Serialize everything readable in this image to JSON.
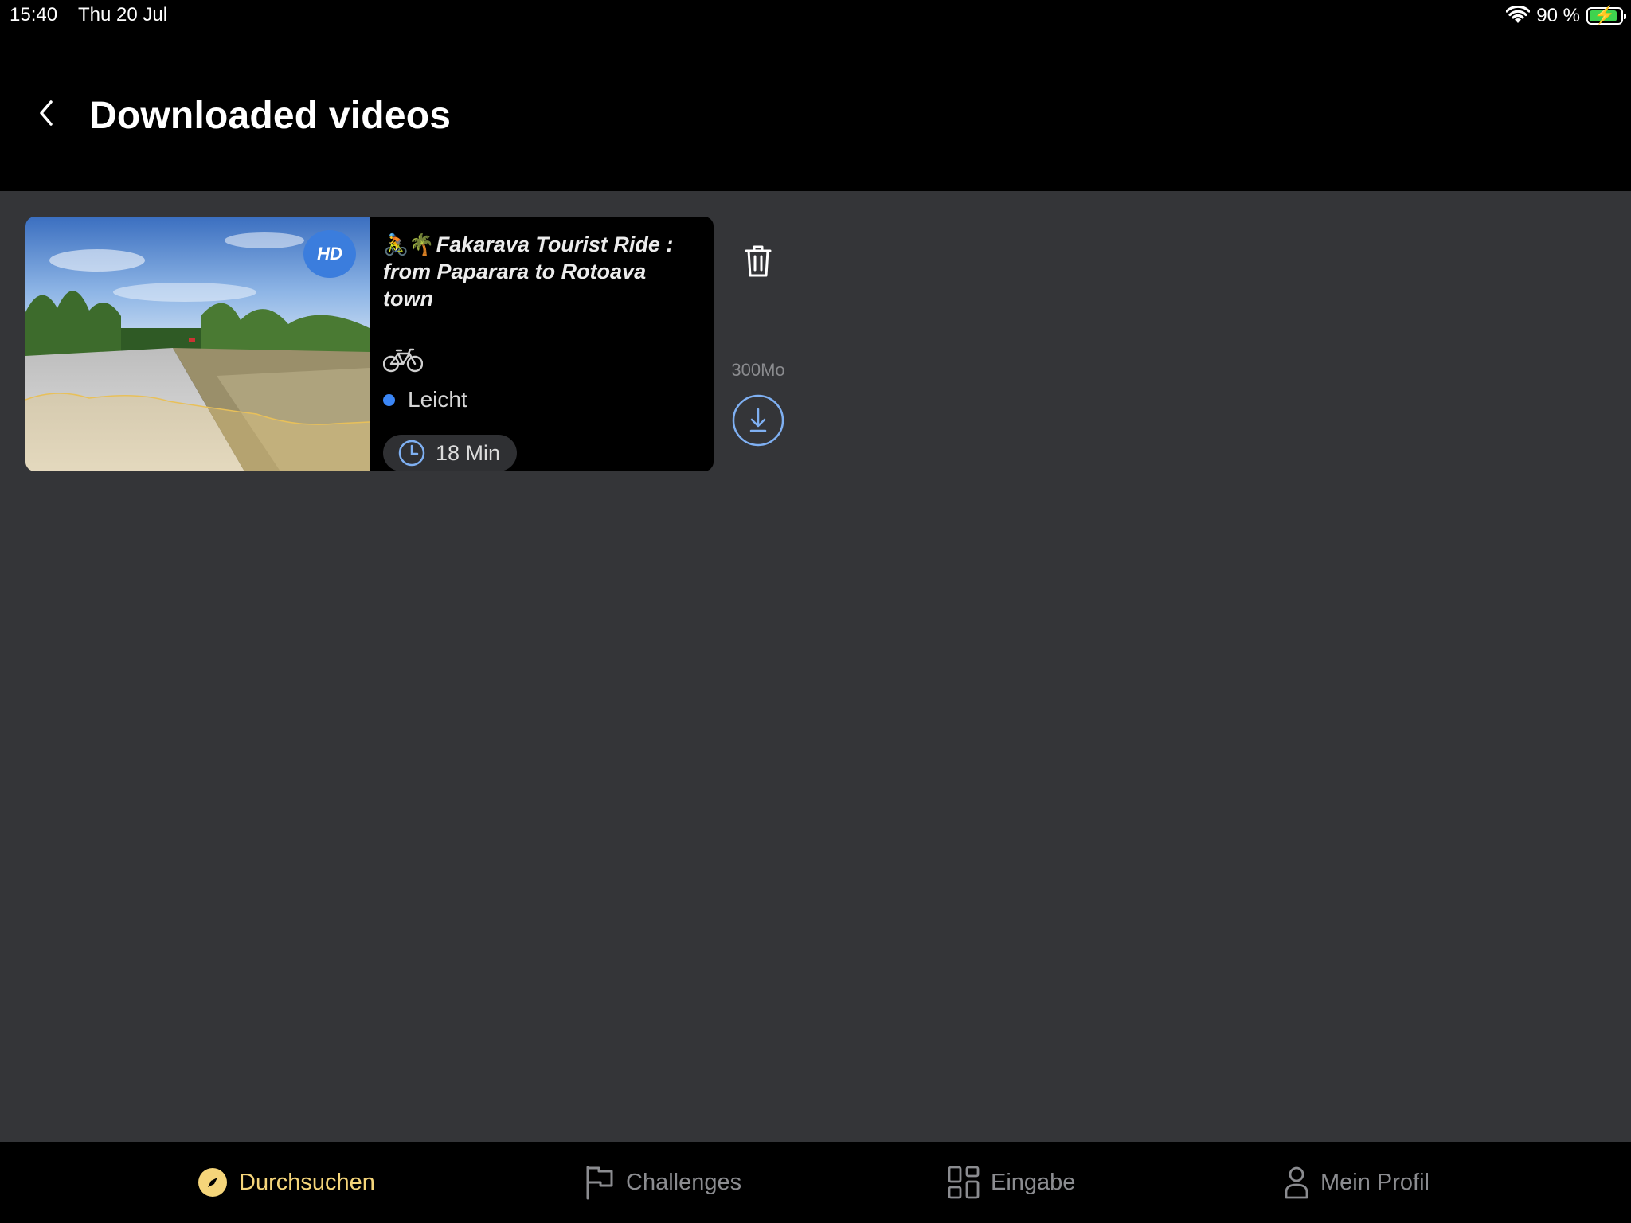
{
  "status_bar": {
    "time": "15:40",
    "date": "Thu 20 Jul",
    "battery_percent": "90 %",
    "battery_level": 0.9
  },
  "header": {
    "title": "Downloaded videos"
  },
  "videos": [
    {
      "badge": "HD",
      "title_emoji": "🚴🌴",
      "title": "Fakarava Tourist Ride : from Paparara to Rotoava town",
      "level": "Leicht",
      "duration": "18 Min",
      "file_size": "300Mo"
    }
  ],
  "tabs": [
    {
      "label": "Durchsuchen",
      "icon": "compass-icon",
      "active": true
    },
    {
      "label": "Challenges",
      "icon": "flag-icon",
      "active": false
    },
    {
      "label": "Eingabe",
      "icon": "grid-icon",
      "active": false
    },
    {
      "label": "Mein Profil",
      "icon": "person-icon",
      "active": false
    }
  ],
  "colors": {
    "background": "#343538",
    "bar": "#000000",
    "accent_active_tab": "#f5d57a",
    "hd_badge": "#3b7ddd",
    "level_dot": "#3b86f6",
    "download_ring": "#7fb0f2",
    "battery": "#3fd34f"
  }
}
